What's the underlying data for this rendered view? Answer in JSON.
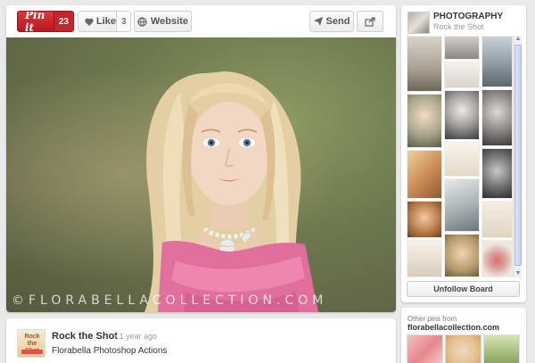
{
  "toolbar": {
    "pin_label": "Pin it",
    "pin_count": "23",
    "like_label": "Like",
    "like_count": "3",
    "website_label": "Website",
    "send_label": "Send"
  },
  "photo": {
    "watermark": "©FLORABELLACOLLECTION.COM"
  },
  "pinner": {
    "thumb_text": "Rock the Shot",
    "name": "Rock the Shot",
    "time": "• 1 year ago",
    "description": "Florabella Photoshop Actions"
  },
  "board": {
    "title": "PHOTOGRAPHY",
    "owner": "Rock the Shot",
    "unfollow_label": "Unfollow Board",
    "scroll_up": "▲",
    "scroll_down": "▼"
  },
  "other_pins": {
    "caption": "Other pins from",
    "source": "florabellacollection.com"
  },
  "colors": {
    "pin_red": "#c1272d",
    "background": "#e9e9e9",
    "scroll_thumb": "#c7d0ee"
  }
}
